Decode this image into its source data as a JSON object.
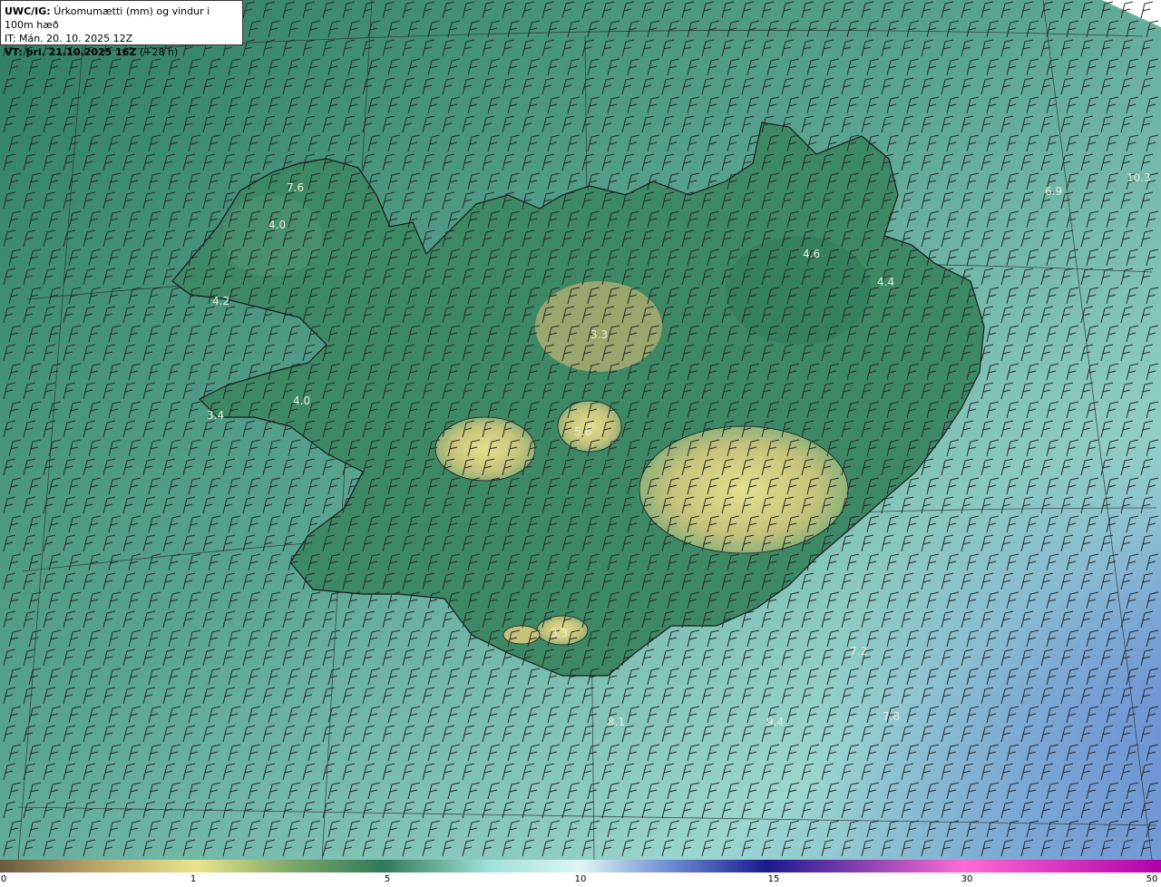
{
  "header": {
    "model_label": "UWC/IG:",
    "title": "Úrkomumætti (mm) og vindur i 100m hæð",
    "issue_time": "IT: Mán. 20. 10. 2025 12Z",
    "valid_label": "VT: þri. 21.10.2025 16Z",
    "valid_offset": "(+28 h)"
  },
  "map_values": [
    "7.6",
    "4.0",
    "4.2",
    "4.0",
    "3.4",
    "3.3",
    "4.6",
    "4.4",
    "3.3",
    "7.8",
    "10.3",
    "6.9",
    "5.6",
    "8.1",
    "9.4",
    "7.2"
  ],
  "colorbar": {
    "ticks": [
      "0",
      "1",
      "5",
      "10",
      "15",
      "30",
      "50"
    ],
    "colors": [
      "#6b5a3e",
      "#b8a36a",
      "#e9e48c",
      "#7fa86a",
      "#2f7a5a",
      "#9fe0d8",
      "#dff5f5",
      "#6a88d0",
      "#1a1a90",
      "#ff6ad5",
      "#b000a8"
    ]
  },
  "colors": {
    "sea": "#6fb6a8",
    "land_low": "#3f8a68",
    "land_high": "#c9c27a",
    "coast": "#1a1a1a",
    "wind_barb": "#2a2a2a"
  }
}
